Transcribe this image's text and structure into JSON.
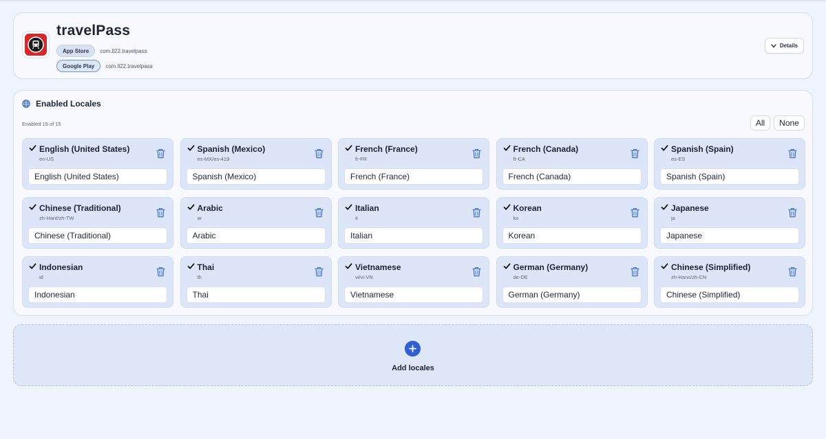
{
  "app": {
    "title": "travelPass",
    "stores": [
      {
        "label": "App Store",
        "bundle_id": "com.ll22.travelpass"
      },
      {
        "label": "Google Play",
        "bundle_id": "com.ll22.travelpass"
      }
    ],
    "details_label": "Details",
    "icon": "train-icon"
  },
  "locales": {
    "title": "Enabled Locales",
    "enabled_count": "Enabled 15 of 15",
    "all_label": "All",
    "none_label": "None",
    "items": [
      {
        "name": "English (United States)",
        "code": "en-US",
        "value": "English (United States)"
      },
      {
        "name": "Spanish (Mexico)",
        "code": "es-MX/es-419",
        "value": "Spanish (Mexico)"
      },
      {
        "name": "French (France)",
        "code": "fr-FR",
        "value": "French (France)"
      },
      {
        "name": "French (Canada)",
        "code": "fr-CA",
        "value": "French (Canada)"
      },
      {
        "name": "Spanish (Spain)",
        "code": "es-ES",
        "value": "Spanish (Spain)"
      },
      {
        "name": "Chinese (Traditional)",
        "code": "zh-Hant/zh-TW",
        "value": "Chinese (Traditional)"
      },
      {
        "name": "Arabic",
        "code": "ar",
        "value": "Arabic"
      },
      {
        "name": "Italian",
        "code": "it",
        "value": "Italian"
      },
      {
        "name": "Korean",
        "code": "ko",
        "value": "Korean"
      },
      {
        "name": "Japanese",
        "code": "ja",
        "value": "Japanese"
      },
      {
        "name": "Indonesian",
        "code": "id",
        "value": "Indonesian"
      },
      {
        "name": "Thai",
        "code": "th",
        "value": "Thai"
      },
      {
        "name": "Vietnamese",
        "code": "vi/vi-VN",
        "value": "Vietnamese"
      },
      {
        "name": "German (Germany)",
        "code": "de-DE",
        "value": "German (Germany)"
      },
      {
        "name": "Chinese (Simplified)",
        "code": "zh-Hans/zh-CN",
        "value": "Chinese (Simplified)"
      }
    ]
  },
  "add": {
    "label": "Add locales"
  },
  "colors": {
    "accent": "#2f5fd0",
    "card_bg": "#dce6f8",
    "trash": "#3b6fd6",
    "app_icon": "#d8262a"
  }
}
